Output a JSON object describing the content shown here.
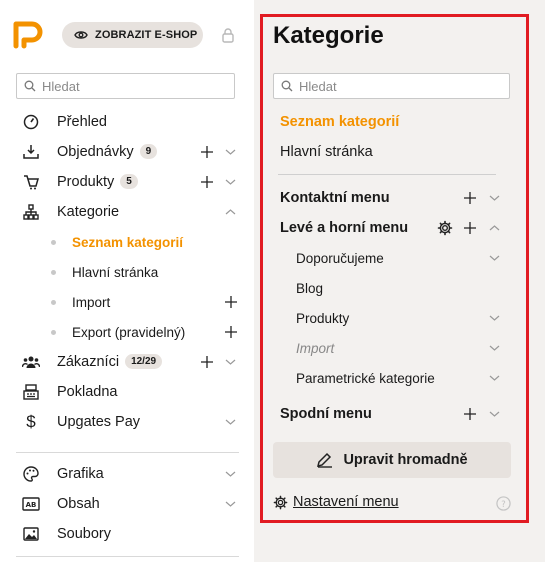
{
  "header": {
    "eshop_button": "ZOBRAZIT E-SHOP"
  },
  "colors": {
    "accent": "#f39200",
    "highlight_frame": "#e11b22",
    "panel_bg": "#f3f1ef",
    "chip_bg": "#e7e2de"
  },
  "sidebar": {
    "search_placeholder": "Hledat",
    "items": [
      {
        "label": "Přehled",
        "icon": "dashboard-icon"
      },
      {
        "label": "Objednávky",
        "badge": "9",
        "icon": "orders-icon"
      },
      {
        "label": "Produkty",
        "badge": "5",
        "icon": "products-icon"
      },
      {
        "label": "Kategorie",
        "icon": "categories-icon"
      },
      {
        "label": "Zákazníci",
        "badge": "12/29",
        "icon": "customers-icon"
      },
      {
        "label": "Pokladna",
        "icon": "cash-register-icon"
      },
      {
        "label": "Upgates Pay",
        "icon": "dollar-icon"
      },
      {
        "label": "Grafika",
        "icon": "palette-icon"
      },
      {
        "label": "Obsah",
        "icon": "content-icon"
      },
      {
        "label": "Soubory",
        "icon": "image-icon"
      }
    ],
    "subitems": [
      {
        "label": "Seznam kategorií"
      },
      {
        "label": "Hlavní stránka"
      },
      {
        "label": "Import"
      },
      {
        "label": "Export (pravidelný)"
      }
    ]
  },
  "panel": {
    "title": "Kategorie",
    "search_placeholder": "Hledat",
    "links": [
      "Seznam kategorií",
      "Hlavní stránka"
    ],
    "menus": {
      "contact": "Kontaktní menu",
      "left_top": "Levé a horní menu",
      "bottom": "Spodní menu"
    },
    "left_top_children": [
      "Doporučujeme",
      "Blog",
      "Produkty",
      "Import",
      "Parametrické kategorie"
    ],
    "bulk_edit": "Upravit hromadně",
    "settings": "Nastavení menu"
  }
}
